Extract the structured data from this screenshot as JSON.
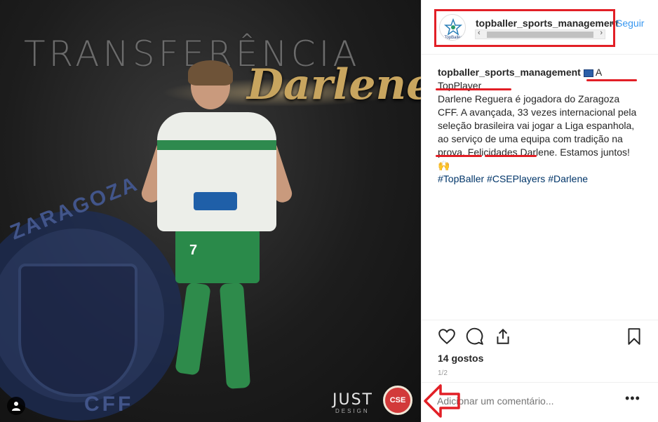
{
  "image": {
    "overlay_title": "TRANSFERÊNCIA",
    "overlay_name": "Darlene",
    "crest_text_top": "ZARAGOZA",
    "crest_text_bottom": "CFF",
    "shirt_number": "7",
    "brand_name": "JUST",
    "brand_sub": "DESIGN",
    "badge_text": "CSE",
    "user_tag_icon": "person-icon"
  },
  "header": {
    "username": "topballer_sports_management",
    "separator": "•",
    "follow_label": "Seguir",
    "avatar_text": "TopBaller"
  },
  "caption": {
    "username": "topballer_sports_management",
    "flag_icon": "flag-icon",
    "line1": "A TopPlayer",
    "line2_name": "Darlene Reguera",
    "line2_rest": " é jogadora do Zaragoza CFF.",
    "body": "A avançada, 33 vezes internacional pela seleção brasileira vai jogar a Liga espanhola, ao serviço de uma equipa com tradição na prova. Felicidades Darlene. Estamos juntos!",
    "emoji": "🙌",
    "hashtags": [
      "#TopBaller",
      "#CSEPlayers",
      "#Darlene"
    ]
  },
  "actions": {
    "like_icon": "heart-icon",
    "comment_icon": "comment-icon",
    "share_icon": "share-icon",
    "save_icon": "bookmark-icon",
    "likes_text": "14 gostos",
    "page_indicator": "1/2"
  },
  "comment": {
    "placeholder": "Adicionar um comentário...",
    "more_label": "•••"
  },
  "annotation_color": "#e21f26"
}
